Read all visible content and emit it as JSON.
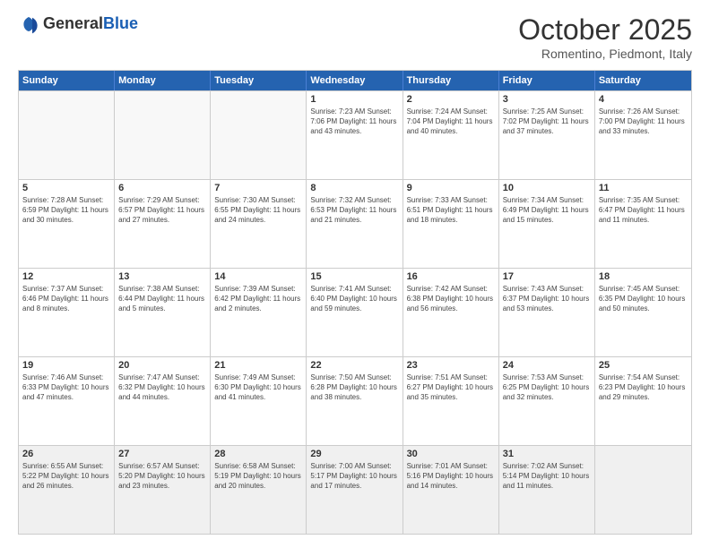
{
  "logo": {
    "general": "General",
    "blue": "Blue"
  },
  "header": {
    "month": "October 2025",
    "location": "Romentino, Piedmont, Italy"
  },
  "weekdays": [
    "Sunday",
    "Monday",
    "Tuesday",
    "Wednesday",
    "Thursday",
    "Friday",
    "Saturday"
  ],
  "rows": [
    [
      {
        "day": "",
        "info": ""
      },
      {
        "day": "",
        "info": ""
      },
      {
        "day": "",
        "info": ""
      },
      {
        "day": "1",
        "info": "Sunrise: 7:23 AM\nSunset: 7:06 PM\nDaylight: 11 hours and 43 minutes."
      },
      {
        "day": "2",
        "info": "Sunrise: 7:24 AM\nSunset: 7:04 PM\nDaylight: 11 hours and 40 minutes."
      },
      {
        "day": "3",
        "info": "Sunrise: 7:25 AM\nSunset: 7:02 PM\nDaylight: 11 hours and 37 minutes."
      },
      {
        "day": "4",
        "info": "Sunrise: 7:26 AM\nSunset: 7:00 PM\nDaylight: 11 hours and 33 minutes."
      }
    ],
    [
      {
        "day": "5",
        "info": "Sunrise: 7:28 AM\nSunset: 6:59 PM\nDaylight: 11 hours and 30 minutes."
      },
      {
        "day": "6",
        "info": "Sunrise: 7:29 AM\nSunset: 6:57 PM\nDaylight: 11 hours and 27 minutes."
      },
      {
        "day": "7",
        "info": "Sunrise: 7:30 AM\nSunset: 6:55 PM\nDaylight: 11 hours and 24 minutes."
      },
      {
        "day": "8",
        "info": "Sunrise: 7:32 AM\nSunset: 6:53 PM\nDaylight: 11 hours and 21 minutes."
      },
      {
        "day": "9",
        "info": "Sunrise: 7:33 AM\nSunset: 6:51 PM\nDaylight: 11 hours and 18 minutes."
      },
      {
        "day": "10",
        "info": "Sunrise: 7:34 AM\nSunset: 6:49 PM\nDaylight: 11 hours and 15 minutes."
      },
      {
        "day": "11",
        "info": "Sunrise: 7:35 AM\nSunset: 6:47 PM\nDaylight: 11 hours and 11 minutes."
      }
    ],
    [
      {
        "day": "12",
        "info": "Sunrise: 7:37 AM\nSunset: 6:46 PM\nDaylight: 11 hours and 8 minutes."
      },
      {
        "day": "13",
        "info": "Sunrise: 7:38 AM\nSunset: 6:44 PM\nDaylight: 11 hours and 5 minutes."
      },
      {
        "day": "14",
        "info": "Sunrise: 7:39 AM\nSunset: 6:42 PM\nDaylight: 11 hours and 2 minutes."
      },
      {
        "day": "15",
        "info": "Sunrise: 7:41 AM\nSunset: 6:40 PM\nDaylight: 10 hours and 59 minutes."
      },
      {
        "day": "16",
        "info": "Sunrise: 7:42 AM\nSunset: 6:38 PM\nDaylight: 10 hours and 56 minutes."
      },
      {
        "day": "17",
        "info": "Sunrise: 7:43 AM\nSunset: 6:37 PM\nDaylight: 10 hours and 53 minutes."
      },
      {
        "day": "18",
        "info": "Sunrise: 7:45 AM\nSunset: 6:35 PM\nDaylight: 10 hours and 50 minutes."
      }
    ],
    [
      {
        "day": "19",
        "info": "Sunrise: 7:46 AM\nSunset: 6:33 PM\nDaylight: 10 hours and 47 minutes."
      },
      {
        "day": "20",
        "info": "Sunrise: 7:47 AM\nSunset: 6:32 PM\nDaylight: 10 hours and 44 minutes."
      },
      {
        "day": "21",
        "info": "Sunrise: 7:49 AM\nSunset: 6:30 PM\nDaylight: 10 hours and 41 minutes."
      },
      {
        "day": "22",
        "info": "Sunrise: 7:50 AM\nSunset: 6:28 PM\nDaylight: 10 hours and 38 minutes."
      },
      {
        "day": "23",
        "info": "Sunrise: 7:51 AM\nSunset: 6:27 PM\nDaylight: 10 hours and 35 minutes."
      },
      {
        "day": "24",
        "info": "Sunrise: 7:53 AM\nSunset: 6:25 PM\nDaylight: 10 hours and 32 minutes."
      },
      {
        "day": "25",
        "info": "Sunrise: 7:54 AM\nSunset: 6:23 PM\nDaylight: 10 hours and 29 minutes."
      }
    ],
    [
      {
        "day": "26",
        "info": "Sunrise: 6:55 AM\nSunset: 5:22 PM\nDaylight: 10 hours and 26 minutes."
      },
      {
        "day": "27",
        "info": "Sunrise: 6:57 AM\nSunset: 5:20 PM\nDaylight: 10 hours and 23 minutes."
      },
      {
        "day": "28",
        "info": "Sunrise: 6:58 AM\nSunset: 5:19 PM\nDaylight: 10 hours and 20 minutes."
      },
      {
        "day": "29",
        "info": "Sunrise: 7:00 AM\nSunset: 5:17 PM\nDaylight: 10 hours and 17 minutes."
      },
      {
        "day": "30",
        "info": "Sunrise: 7:01 AM\nSunset: 5:16 PM\nDaylight: 10 hours and 14 minutes."
      },
      {
        "day": "31",
        "info": "Sunrise: 7:02 AM\nSunset: 5:14 PM\nDaylight: 10 hours and 11 minutes."
      },
      {
        "day": "",
        "info": ""
      }
    ]
  ]
}
